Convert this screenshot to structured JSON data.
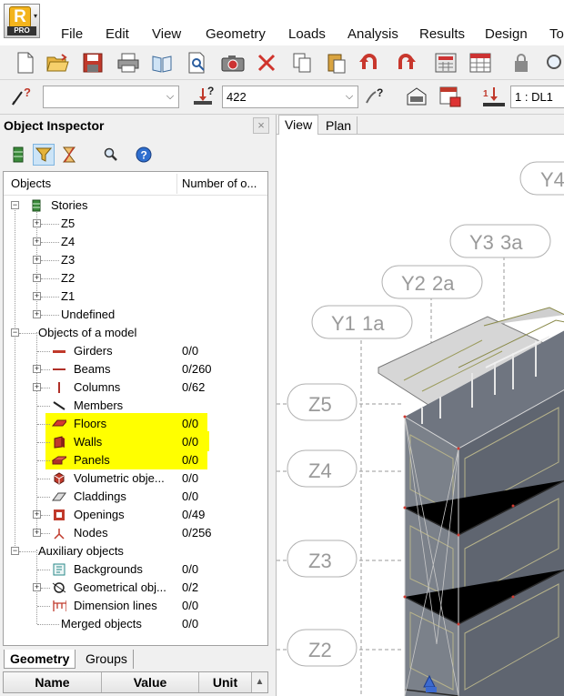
{
  "app": {
    "logo_letter": "R",
    "logo_badge": "PRO"
  },
  "menu": [
    "File",
    "Edit",
    "View",
    "Geometry",
    "Loads",
    "Analysis",
    "Results",
    "Design",
    "To"
  ],
  "toolbar2": {
    "selection_value": "",
    "cases_value": "422",
    "load_case_value": "1 : DL1"
  },
  "inspector": {
    "title": "Object Inspector",
    "close_glyph": "×",
    "columns": {
      "objects": "Objects",
      "number": "Number of o..."
    }
  },
  "tree": {
    "stories": {
      "label": "Stories",
      "children": [
        "Z5",
        "Z4",
        "Z3",
        "Z2",
        "Z1",
        "Undefined"
      ]
    },
    "model": {
      "label": "Objects of a model",
      "items": [
        {
          "label": "Girders",
          "count": "0/0"
        },
        {
          "label": "Beams",
          "count": "0/260"
        },
        {
          "label": "Columns",
          "count": "0/62"
        },
        {
          "label": "Members",
          "count": ""
        },
        {
          "label": "Floors",
          "count": "0/0"
        },
        {
          "label": "Walls",
          "count": "0/0"
        },
        {
          "label": "Panels",
          "count": "0/0"
        },
        {
          "label": "Volumetric obje...",
          "count": "0/0"
        },
        {
          "label": "Claddings",
          "count": "0/0"
        },
        {
          "label": "Openings",
          "count": "0/49"
        },
        {
          "label": "Nodes",
          "count": "0/256"
        }
      ]
    },
    "auxiliary": {
      "label": "Auxiliary objects",
      "items": [
        {
          "label": "Backgrounds",
          "count": "0/0"
        },
        {
          "label": "Geometrical obj...",
          "count": "0/2"
        },
        {
          "label": "Dimension lines",
          "count": "0/0"
        },
        {
          "label": "Merged objects",
          "count": "0/0"
        }
      ]
    },
    "highlight_color": "#ffff00"
  },
  "bottom_tabs": {
    "geometry": "Geometry",
    "groups": "Groups"
  },
  "properties": {
    "name": "Name",
    "value": "Value",
    "unit": "Unit"
  },
  "view": {
    "tabs": {
      "view": "View",
      "plan": "Plan"
    },
    "axis_labels": [
      "Y1",
      "1a",
      "Y2",
      "2a",
      "Y3",
      "3a",
      "Y4"
    ],
    "story_labels": [
      "Z5",
      "Z4",
      "Z3",
      "Z2"
    ]
  }
}
